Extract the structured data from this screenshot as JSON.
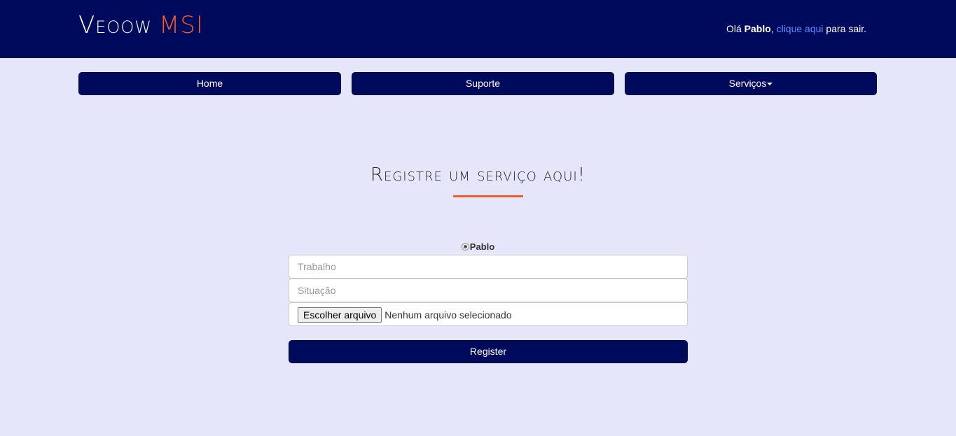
{
  "header": {
    "brand_main": "Veoow",
    "brand_accent": "MSI",
    "greeting_prefix": "Olá ",
    "user_name": "Pablo",
    "greeting_comma": ", ",
    "logout_link": "clique aqui",
    "greeting_suffix": " para sair."
  },
  "nav": {
    "home": "Home",
    "support": "Suporte",
    "services": "Serviços"
  },
  "main": {
    "title": "Registre um serviço aqui!",
    "radio_label": "Pablo",
    "job_placeholder": "Trabalho",
    "status_placeholder": "Situação",
    "file_button": "Escolher arquivo",
    "file_status": "Nenhum arquivo selecionado",
    "submit_label": "Register"
  },
  "colors": {
    "navy": "#000a5c",
    "accent": "#f25a28",
    "background": "#e6e6fa",
    "link": "#5b8cff"
  }
}
